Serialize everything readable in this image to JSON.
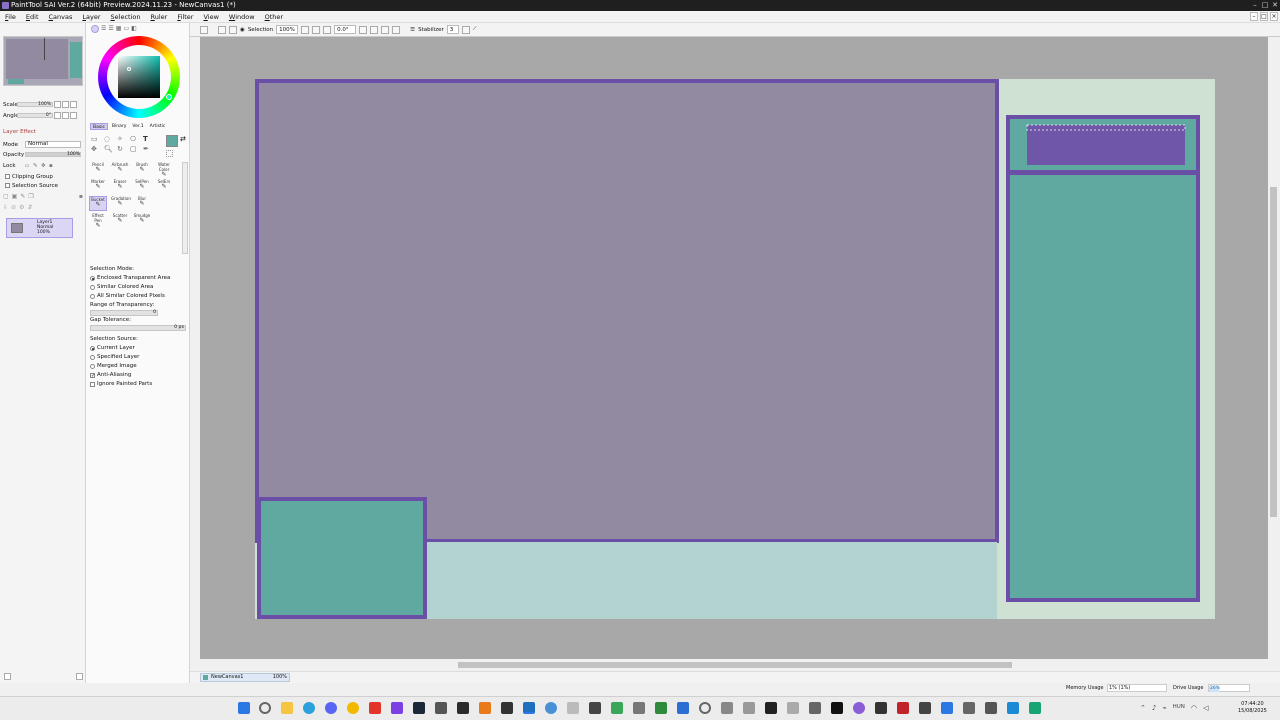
{
  "window": {
    "title": "PaintTool SAI Ver.2 (64bit) Preview.2024.11.23 - NewCanvas1 (*)",
    "buttons": [
      "–",
      "□",
      "✕"
    ]
  },
  "menu": [
    "File",
    "Edit",
    "Canvas",
    "Layer",
    "Selection",
    "Ruler",
    "Filter",
    "View",
    "Window",
    "Other"
  ],
  "navigator": {
    "scale_label": "Scale",
    "scale_value": "100%",
    "angle_label": "Angle",
    "angle_value": "0°"
  },
  "layer_panel": {
    "section": "Layer Effect",
    "mode_label": "Mode",
    "mode_value": "Normal",
    "opacity_label": "Opacity",
    "opacity_value": "100%",
    "lock_label": "Lock",
    "clipping_group": "Clipping Group",
    "selection_source": "Selection Source",
    "layer": {
      "name": "Layer1",
      "mode": "Normal",
      "opacity": "100%"
    }
  },
  "color": {
    "current": "#5fa9a0",
    "tabs": [
      "Basic",
      "Binary",
      "Ver.1",
      "Artistic"
    ],
    "active_tab": "Basic"
  },
  "tools": [
    {
      "label": "Pencil"
    },
    {
      "label": "Airbrush"
    },
    {
      "label": "Brush"
    },
    {
      "label": "Water Color"
    },
    {
      "label": "Marker"
    },
    {
      "label": "Eraser"
    },
    {
      "label": "SelPen"
    },
    {
      "label": "SelErs"
    },
    {
      "label": "Bucket"
    },
    {
      "label": "Gradation"
    },
    {
      "label": "Blur"
    },
    {
      "label": ""
    },
    {
      "label": "Effect Pen"
    },
    {
      "label": "Scatter"
    },
    {
      "label": "Smudge"
    },
    {
      "label": ""
    }
  ],
  "active_tool": "Bucket",
  "bucket_options": {
    "selection_mode_label": "Selection Mode:",
    "modes": [
      "Enclosed Transparent Area",
      "Similar Colored Area",
      "All Similar Colored Pixels"
    ],
    "active_mode": 0,
    "range_label": "Range of Transparency:",
    "range_value": "0",
    "gap_label": "Gap Tolerance:",
    "gap_value": "0 px",
    "source_label": "Selection Source:",
    "sources": [
      "Current Layer",
      "Specified Layer",
      "Merged Image"
    ],
    "active_source": 0,
    "anti_aliasing": "Anti-Aliasing",
    "anti_aliasing_checked": true,
    "ignore_painted": "Ignore Painted Parts",
    "ignore_painted_checked": false
  },
  "toolbar": {
    "selection_label": "Selection",
    "zoom": "100%",
    "angle": "0.0°",
    "stabilizer_label": "Stabilizer",
    "stabilizer_value": "3"
  },
  "document": {
    "tab_name": "NewCanvas1",
    "tab_zoom": "100%"
  },
  "status": {
    "memory_label": "Memory Usage",
    "memory_value": "1% (1%)",
    "drive_label": "Drive Usage",
    "drive_value": "26%"
  },
  "taskbar": {
    "language": "HUN",
    "time": "07:44:20",
    "date": "15/08/2025"
  },
  "colors": {
    "canvas_bg": "#cfe1d3",
    "purple_border": "#6b4fa6",
    "gray_fill": "#918aa0",
    "teal_fill": "#5fa9a0",
    "light_teal": "#b3d3d0",
    "selection_fill": "#7056a8"
  }
}
